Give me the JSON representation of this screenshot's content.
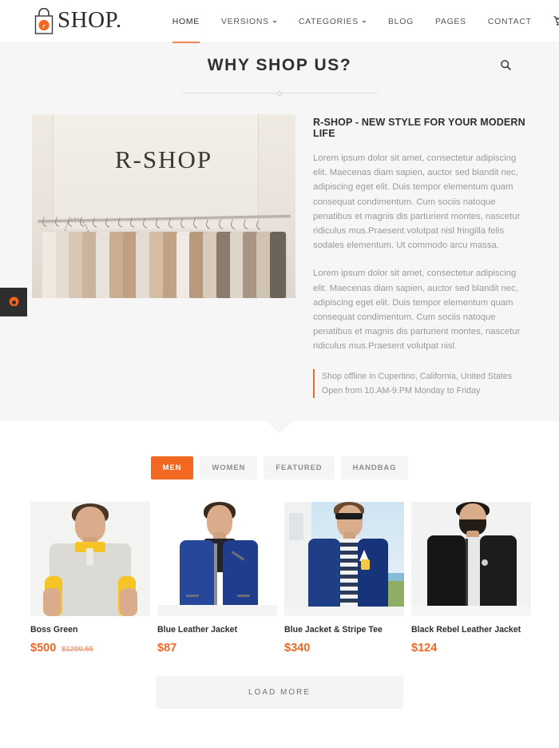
{
  "header": {
    "logo": {
      "text": "SHOP.",
      "mark": "shopping-bag-icon",
      "badge_letter": "r"
    },
    "nav": [
      {
        "label": "HOME",
        "active": true,
        "caret": false
      },
      {
        "label": "VERSIONS",
        "active": false,
        "caret": true
      },
      {
        "label": "CATEGORIES",
        "active": false,
        "caret": true
      },
      {
        "label": "BLOG",
        "active": false,
        "caret": false
      },
      {
        "label": "PAGES",
        "active": false,
        "caret": false
      },
      {
        "label": "CONTACT",
        "active": false,
        "caret": false
      }
    ],
    "cart_icon": "shopping-cart-icon"
  },
  "hero": {
    "section_title": "WHY SHOP US?",
    "search_icon": "search-icon",
    "photo": {
      "sign_text": "R-SHOP",
      "alt": "clothing rack with hangers in a shop"
    },
    "title": "R-SHOP - NEW STYLE FOR YOUR MODERN LIFE",
    "paragraph_1": "Lorem ipsum dolor sit amet, consectetur adipiscing elit. Maecenas diam sapien, auctor sed blandit nec, adipiscing eget elit. Duis tempor elementum quam consequat condimentum. Cum sociis natoque penatibus et magnis dis parturient montes, nascetur ridiculus mus.Praesent volutpat nisl fringilla felis sodales elementum. Ut commodo arcu massa.",
    "paragraph_2": "Lorem ipsum dolor sit amet, consectetur adipiscing elit. Maecenas diam sapien, auctor sed blandit nec, adipiscing eget elit. Duis tempor elementum quam consequat condimentum. Cum sociis natoque penatibus et magnis dis parturient montes, nascetur ridiculus mus.Praesent volutpat nisl.",
    "quote_line_1": "Shop offline in Cupertino, California, United States",
    "quote_line_2": "Open from 10.AM-9.PM Monday to Friday"
  },
  "settings_tab": {
    "icon": "gear-icon"
  },
  "filters": [
    {
      "label": "MEN",
      "active": true
    },
    {
      "label": "WOMEN",
      "active": false
    },
    {
      "label": "FEATURED",
      "active": false
    },
    {
      "label": "HANDBAG",
      "active": false
    }
  ],
  "products": [
    {
      "name": "Boss Green",
      "price": "$500",
      "old_price": "$1200.55",
      "alt": "man in grey polo shirt with yellow collar"
    },
    {
      "name": "Blue Leather Jacket",
      "price": "$87",
      "old_price": "",
      "alt": "man in blue leather jacket"
    },
    {
      "name": "Blue Jacket & Stripe Tee",
      "price": "$340",
      "old_price": "",
      "alt": "man in blue blazer with striped tee and sunglasses"
    },
    {
      "name": "Black Rebel Leather Jacket",
      "price": "$124",
      "old_price": "",
      "alt": "bearded man in black leather jacket"
    }
  ],
  "load_more": {
    "label": "LOAD MORE"
  },
  "colors": {
    "accent": "#f26722",
    "accent_soft": "#f3835a",
    "section_bg": "#f6f6f6",
    "text_dark": "#2e2e2e",
    "text_muted": "#9a9a9a"
  }
}
